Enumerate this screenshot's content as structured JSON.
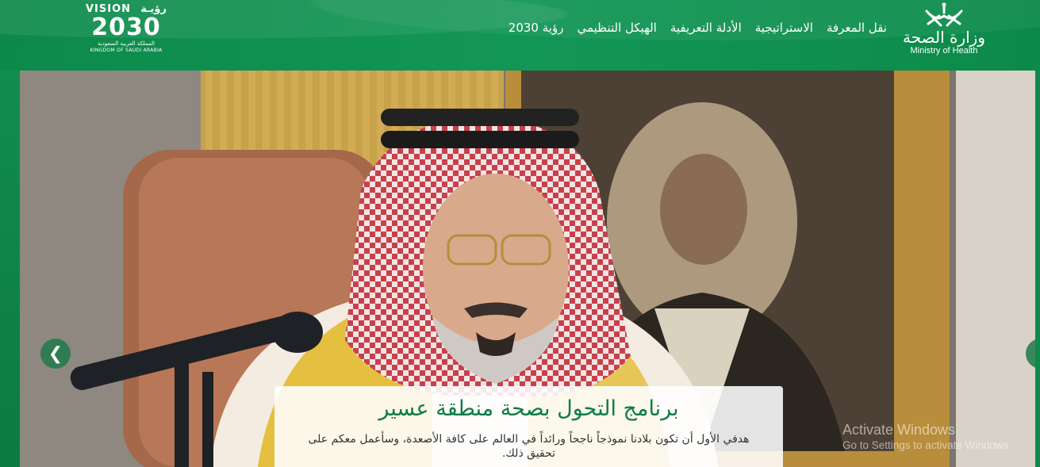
{
  "header": {
    "vision_logo": {
      "vision_word": "VISION",
      "vision_ar": "رؤيـة",
      "number": "2030",
      "kingdom_ar": "المملكة العربية السعودية",
      "kingdom_en": "KINGDOM OF SAUDI ARABIA"
    },
    "nav": [
      {
        "label": "رؤية 2030"
      },
      {
        "label": "الهيكل التنظيمي"
      },
      {
        "label": "الأدلة التعريفية"
      },
      {
        "label": "الاستراتيجية"
      },
      {
        "label": "نقل المعرفة"
      }
    ],
    "ministry_logo": {
      "name_ar": "وزارة الصحة",
      "name_en": "Ministry of Health"
    }
  },
  "slider": {
    "prev_icon": "chevron-left-icon",
    "next_icon": "chevron-right-icon",
    "caption": {
      "title": "برنامج التحول بصحة منطقة عسير",
      "body": "هدفي الأول أن تكون بلادنا نموذجاً ناجحاً ورائداً في العالم على كافة الأصعدة، وسأعمل معكم على تحقيق ذلك."
    }
  },
  "watermark": {
    "title": "Activate Windows",
    "subtitle": "Go to Settings to activate Windows."
  },
  "colors": {
    "brand_green": "#0f8a4c",
    "caption_title": "#0e7d44"
  }
}
